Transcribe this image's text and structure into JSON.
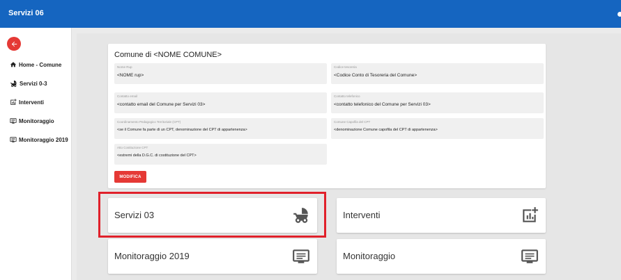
{
  "app": {
    "title": "Servizi 06"
  },
  "colors": {
    "topbar": "#1565c0",
    "accent": "#e53935",
    "highlight": "#e0202a"
  },
  "sidebar": {
    "back_icon": "arrow-left-icon",
    "items": [
      {
        "label": "Home - Comune",
        "icon": "home-icon"
      },
      {
        "label": "Servizi 0-3",
        "icon": "stroller-icon"
      },
      {
        "label": "Interventi",
        "icon": "chart-plus-icon"
      },
      {
        "label": "Monitoraggio",
        "icon": "monitor-icon"
      },
      {
        "label": "Monitoraggio 2019",
        "icon": "monitor-icon"
      }
    ]
  },
  "info_card": {
    "title": "Comune di  <NOME COMUNE>",
    "fields": [
      {
        "label": "Nome Rup",
        "value": "<NOME rup>"
      },
      {
        "label": "Codice tesoreria",
        "value": "<Codice Conto di Tesoreria del Comune>"
      },
      {
        "label": "Contatto email",
        "value": "<contatto email del Comune per Servizi 03>"
      },
      {
        "label": "Contatto telefonico",
        "value": "<contatto telefonico del Comune per Servizi 03>"
      },
      {
        "label": "Coordinamento Pedagogico Territoriale (CPT)",
        "value": "<se il Comune fa parte di un CPT, denominazione del CPT di appartenenza>"
      },
      {
        "label": "Comune Capofila del CPT",
        "value": "<denominazione Comune capofila del CPT di appartenenza>"
      },
      {
        "label": "Atto Costituzione CPT",
        "value": "<estremi della D.G.C. di costituzione del CPT>"
      }
    ],
    "edit_button": "MODIFICA"
  },
  "tiles": [
    {
      "label": "Servizi 03",
      "icon": "stroller-icon"
    },
    {
      "label": "Interventi",
      "icon": "chart-plus-icon"
    },
    {
      "label": "Monitoraggio 2019",
      "icon": "monitor-icon"
    },
    {
      "label": "Monitoraggio",
      "icon": "monitor-icon"
    }
  ]
}
